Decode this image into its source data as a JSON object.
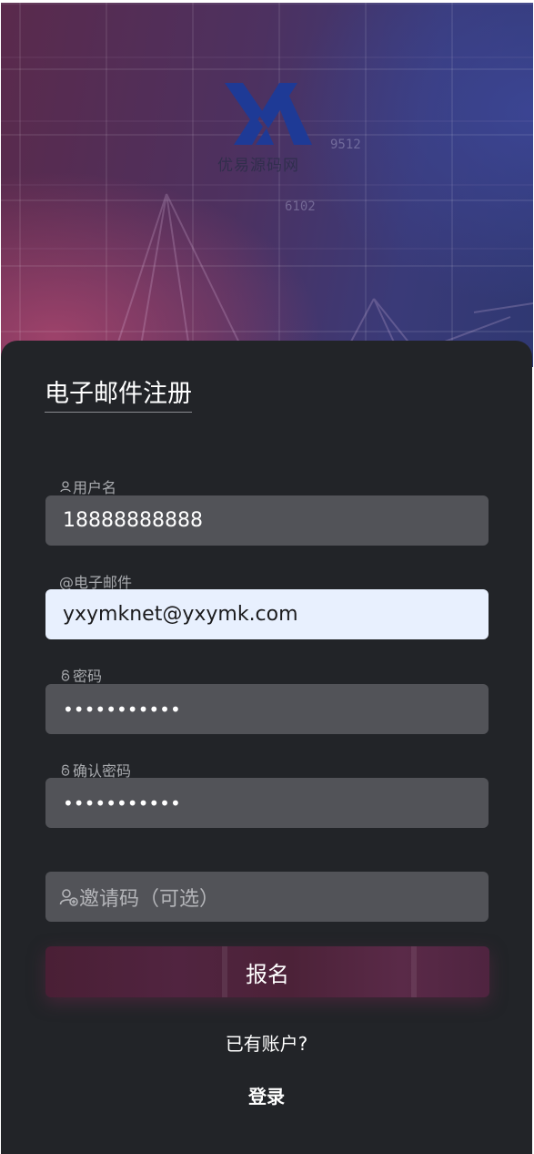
{
  "hero": {
    "logo_text": "优易源码网",
    "sketch_numbers": [
      "9512",
      "6102"
    ]
  },
  "form": {
    "title": "电子邮件注册",
    "username": {
      "label": "用户名",
      "value": "18888888888"
    },
    "email": {
      "label": "@电子邮件",
      "value": "yxymknet@yxymk.com"
    },
    "password": {
      "label": "密码",
      "value": "•••••••••••"
    },
    "confirm_password": {
      "label": "确认密码",
      "value": "•••••••••••"
    },
    "invite_code": {
      "placeholder": "邀请码（可选）"
    },
    "submit_label": "报名",
    "have_account_text": "已有账户?",
    "login_label": "登录"
  },
  "colors": {
    "card_background": "#222428",
    "field_background": "#525358",
    "autofill_background": "#e8f0fe",
    "button_color": "#4e2240",
    "logo_color": "#1e3a96"
  },
  "icons": {
    "username": "user-icon",
    "password": "lock-icon",
    "confirm_password": "lock-icon",
    "invite_code": "user-add-icon"
  }
}
